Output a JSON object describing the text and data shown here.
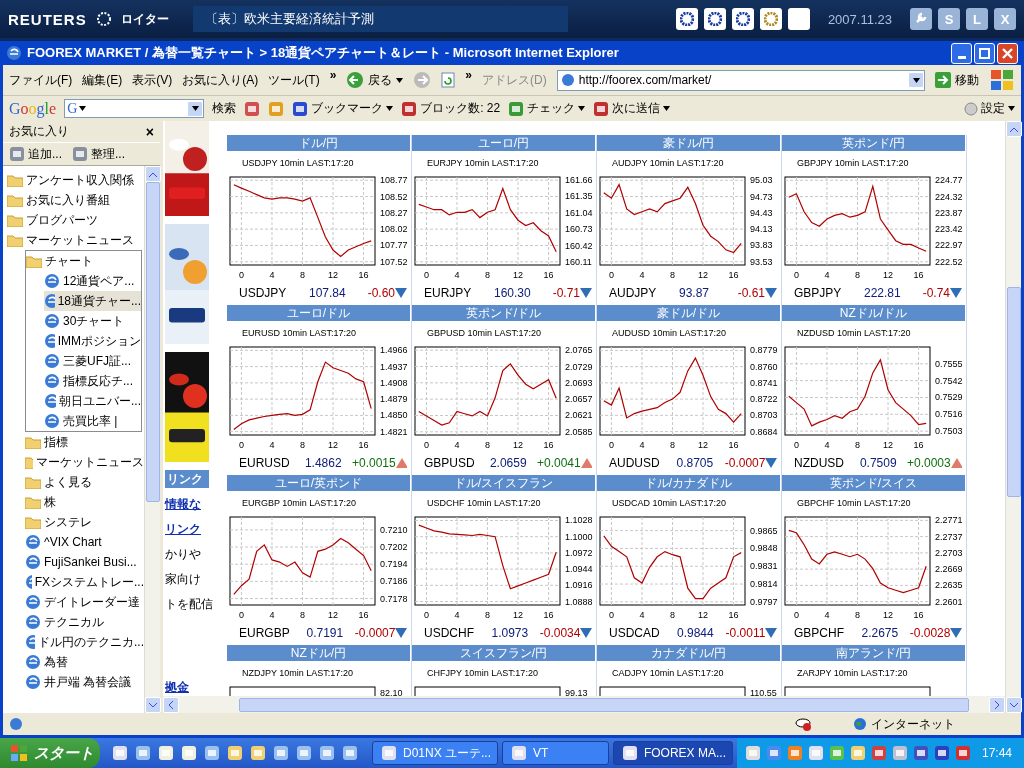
{
  "reuters": {
    "brand": "REUTERS",
    "brand_jp": "ロイター",
    "headline": "〔表〕欧米主要経済統計予測",
    "date": "2007.11.23",
    "buttons": [
      "S",
      "L",
      "X"
    ]
  },
  "window": {
    "title": "FOOREX MARKET / 為替一覧チャート > 18通貨ペアチャート＆レート - Microsoft Internet Explorer",
    "menu": [
      "ファイル(F)",
      "編集(E)",
      "表示(V)",
      "お気に入り(A)",
      "ツール(T)"
    ],
    "menu_chevron": "»",
    "back": "戻る",
    "nav_chevron": "»",
    "address_label": "アドレス(D)",
    "url": "http://foorex.com/market/",
    "go": "移動"
  },
  "google_bar": {
    "logo": "Google",
    "combo": "G",
    "search": "検索",
    "items": [
      {
        "label": "ブックマーク",
        "menu": true
      },
      {
        "label": "ブロック数: 22",
        "menu": false
      },
      {
        "label": "チェック",
        "menu": true
      },
      {
        "label": "次に送信",
        "menu": true
      }
    ],
    "settings": "設定"
  },
  "favorites": {
    "title": "お気に入り",
    "close": "×",
    "actions": [
      "追加...",
      "整理..."
    ],
    "items": [
      {
        "kind": "folder",
        "label": "アンケート収入関係",
        "selected": false
      },
      {
        "kind": "folder",
        "label": "お気に入り番組",
        "selected": false
      },
      {
        "kind": "folder",
        "label": "ブログパーツ",
        "selected": false
      },
      {
        "kind": "folder",
        "label": "マーケットニュース",
        "selected": false,
        "children": [
          {
            "kind": "folder",
            "label": "チャート",
            "selected": false,
            "children": [
              {
                "kind": "link",
                "label": "12通貨ペア...",
                "selected": false
              },
              {
                "kind": "link",
                "label": "18通貨チャー...",
                "selected": true
              },
              {
                "kind": "link",
                "label": "30チャート",
                "selected": false
              },
              {
                "kind": "link",
                "label": "IMMポジション",
                "selected": false
              },
              {
                "kind": "link",
                "label": "三菱UFJ証...",
                "selected": false
              },
              {
                "kind": "link",
                "label": "指標反応チ...",
                "selected": false
              },
              {
                "kind": "link",
                "label": "朝日ユニバー...",
                "selected": false
              },
              {
                "kind": "link",
                "label": "売買比率 |",
                "selected": false
              }
            ]
          },
          {
            "kind": "folder",
            "label": "指標",
            "selected": false
          },
          {
            "kind": "folder",
            "label": "マーケットニュース",
            "selected": false
          },
          {
            "kind": "folder",
            "label": "よく見る",
            "selected": false
          },
          {
            "kind": "folder",
            "label": "株",
            "selected": false
          },
          {
            "kind": "folder",
            "label": "システレ",
            "selected": false
          },
          {
            "kind": "link",
            "label": "^VIX Chart",
            "selected": false
          },
          {
            "kind": "link",
            "label": "FujiSankei Busi...",
            "selected": false
          },
          {
            "kind": "link",
            "label": "FXシステムトレー...",
            "selected": false
          },
          {
            "kind": "link",
            "label": "デイトレーダー達",
            "selected": false
          },
          {
            "kind": "link",
            "label": "テクニカル",
            "selected": false
          },
          {
            "kind": "link",
            "label": "ドル円のテクニカ...",
            "selected": false
          },
          {
            "kind": "link",
            "label": "為替",
            "selected": false
          },
          {
            "kind": "link",
            "label": "井戸端 為替会議",
            "selected": false
          }
        ]
      }
    ]
  },
  "side_column": {
    "ads": [
      {
        "kind": "picture"
      },
      {
        "kind": "picture"
      },
      {
        "kind": "picture"
      }
    ],
    "heading": "リンク",
    "links": [
      "情報な",
      "リンク"
    ],
    "lines": [
      "かりや",
      "家向け",
      "トを配信"
    ],
    "bottom_link": "拠金"
  },
  "panels": [
    {
      "kind": "chart",
      "heading": "ドル/円",
      "caption": "USDJPY 10min LAST:17:20",
      "symbol": "USDJPY",
      "price": "107.84",
      "change": "-0.60",
      "rising": false,
      "chart_data": {
        "type": "line",
        "grid": true,
        "x": [
          -1,
          0,
          1,
          2,
          3,
          4,
          5,
          6,
          7,
          8,
          9,
          10,
          11,
          12,
          13,
          14,
          15,
          16,
          17
        ],
        "xlim": [
          -1.5,
          17.5
        ],
        "ylim": [
          107.47,
          108.82
        ],
        "xticks": [
          0,
          4,
          8,
          12,
          16
        ],
        "yticks": [
          {
            "value": 108.77,
            "label": "108.77"
          },
          {
            "value": 108.52,
            "label": "108.52"
          },
          {
            "value": 108.27,
            "label": "108.27"
          },
          {
            "value": 108.02,
            "label": "108.02"
          },
          {
            "value": 107.77,
            "label": "107.77"
          },
          {
            "value": 107.52,
            "label": "107.52"
          }
        ],
        "series": [
          {
            "color": "#b00000",
            "values": [
              108.7,
              108.65,
              108.6,
              108.55,
              108.5,
              108.48,
              108.5,
              108.5,
              108.48,
              108.45,
              108.5,
              108.2,
              107.9,
              107.7,
              107.6,
              107.7,
              107.75,
              107.8,
              107.84
            ]
          }
        ]
      }
    },
    {
      "kind": "chart",
      "heading": "ユーロ/円",
      "caption": "EURJPY 10min LAST:17:20",
      "symbol": "EURJPY",
      "price": "160.30",
      "change": "-0.71",
      "rising": false,
      "chart_data": {
        "type": "line",
        "grid": true,
        "x": [
          -1,
          0,
          1,
          2,
          3,
          4,
          5,
          6,
          7,
          8,
          9,
          10,
          11,
          12,
          13,
          14,
          15,
          16,
          17
        ],
        "xlim": [
          -1.5,
          17.5
        ],
        "ylim": [
          160.05,
          161.72
        ],
        "xticks": [
          0,
          4,
          8,
          12,
          16
        ],
        "yticks": [
          {
            "value": 161.66,
            "label": "161.66"
          },
          {
            "value": 161.35,
            "label": "161.35"
          },
          {
            "value": 161.04,
            "label": "161.04"
          },
          {
            "value": 160.73,
            "label": "160.73"
          },
          {
            "value": 160.42,
            "label": "160.42"
          },
          {
            "value": 160.11,
            "label": "160.11"
          }
        ],
        "series": [
          {
            "color": "#b00000",
            "values": [
              161.2,
              161.15,
              161.1,
              161.1,
              161.0,
              161.05,
              161.05,
              161.1,
              160.95,
              161.05,
              161.1,
              161.5,
              161.1,
              160.9,
              160.8,
              160.85,
              160.7,
              160.6,
              160.3
            ]
          }
        ]
      }
    },
    {
      "kind": "chart",
      "heading": "豪ドル/円",
      "caption": "AUDJPY 10min LAST:17:20",
      "symbol": "AUDJPY",
      "price": "93.87",
      "change": "-0.61",
      "rising": false,
      "chart_data": {
        "type": "line",
        "grid": true,
        "x": [
          -1,
          0,
          1,
          2,
          3,
          4,
          5,
          6,
          7,
          8,
          9,
          10,
          11,
          12,
          13,
          14,
          15,
          16,
          17
        ],
        "xlim": [
          -1.5,
          17.5
        ],
        "ylim": [
          93.47,
          95.09
        ],
        "xticks": [
          0,
          4,
          8,
          12,
          16
        ],
        "yticks": [
          {
            "value": 95.03,
            "label": "95.03"
          },
          {
            "value": 94.73,
            "label": "94.73"
          },
          {
            "value": 94.43,
            "label": "94.43"
          },
          {
            "value": 94.13,
            "label": "94.13"
          },
          {
            "value": 93.83,
            "label": "93.83"
          },
          {
            "value": 93.53,
            "label": "93.53"
          }
        ],
        "series": [
          {
            "color": "#b00000",
            "values": [
              94.8,
              94.7,
              94.95,
              94.5,
              94.4,
              94.45,
              94.5,
              94.45,
              94.6,
              94.65,
              94.7,
              94.9,
              94.6,
              94.2,
              94.0,
              93.9,
              93.75,
              93.7,
              93.87
            ]
          }
        ]
      }
    },
    {
      "kind": "chart",
      "heading": "英ポンド/円",
      "caption": "GBPJPY 10min LAST:17:20",
      "symbol": "GBPJPY",
      "price": "222.81",
      "change": "-0.74",
      "rising": false,
      "chart_data": {
        "type": "line",
        "grid": true,
        "x": [
          -1,
          0,
          1,
          2,
          3,
          4,
          5,
          6,
          7,
          8,
          9,
          10,
          11,
          12,
          13,
          14,
          15,
          16,
          17
        ],
        "xlim": [
          -1.5,
          17.5
        ],
        "ylim": [
          222.43,
          224.86
        ],
        "xticks": [
          0,
          4,
          8,
          12,
          16
        ],
        "yticks": [
          {
            "value": 224.77,
            "label": "224.77"
          },
          {
            "value": 224.32,
            "label": "224.32"
          },
          {
            "value": 223.87,
            "label": "223.87"
          },
          {
            "value": 223.42,
            "label": "223.42"
          },
          {
            "value": 222.97,
            "label": "222.97"
          },
          {
            "value": 222.52,
            "label": "222.52"
          }
        ],
        "series": [
          {
            "color": "#b00000",
            "values": [
              224.3,
              224.4,
              223.9,
              223.6,
              223.5,
              223.7,
              223.8,
              223.85,
              223.75,
              223.8,
              223.9,
              224.6,
              223.7,
              223.4,
              223.1,
              223.0,
              223.0,
              222.9,
              222.81
            ]
          }
        ]
      }
    },
    {
      "kind": "chart",
      "heading": "ユーロ/ドル",
      "caption": "EURUSD 10min LAST:17:20",
      "symbol": "EURUSD",
      "price": "1.4862",
      "change": "+0.0015",
      "rising": true,
      "chart_data": {
        "type": "line",
        "grid": true,
        "x": [
          -1,
          0,
          1,
          2,
          3,
          4,
          5,
          6,
          7,
          8,
          9,
          10,
          11,
          12,
          13,
          14,
          15,
          16,
          17
        ],
        "xlim": [
          -1.5,
          17.5
        ],
        "ylim": [
          1.4815,
          1.4972
        ],
        "xticks": [
          0,
          4,
          8,
          12,
          16
        ],
        "yticks": [
          {
            "value": 1.4966,
            "label": "1.4966"
          },
          {
            "value": 1.4937,
            "label": "1.4937"
          },
          {
            "value": 1.4908,
            "label": "1.4908"
          },
          {
            "value": 1.4879,
            "label": "1.4879"
          },
          {
            "value": 1.485,
            "label": "1.4850"
          },
          {
            "value": 1.4821,
            "label": "1.4821"
          }
        ],
        "series": [
          {
            "color": "#b00000",
            "values": [
              1.4825,
              1.4835,
              1.4842,
              1.4845,
              1.4848,
              1.485,
              1.4852,
              1.4853,
              1.485,
              1.4852,
              1.486,
              1.491,
              1.4945,
              1.4935,
              1.493,
              1.4925,
              1.4915,
              1.491,
              1.4862
            ]
          }
        ]
      }
    },
    {
      "kind": "chart",
      "heading": "英ポンド/ドル",
      "caption": "GBPUSD 10min LAST:17:20",
      "symbol": "GBPUSD",
      "price": "2.0659",
      "change": "+0.0041",
      "rising": true,
      "chart_data": {
        "type": "line",
        "grid": true,
        "x": [
          -1,
          0,
          1,
          2,
          3,
          4,
          5,
          6,
          7,
          8,
          9,
          10,
          11,
          12,
          13,
          14,
          15,
          16,
          17
        ],
        "xlim": [
          -1.5,
          17.5
        ],
        "ylim": [
          2.0578,
          2.0772
        ],
        "xticks": [
          0,
          4,
          8,
          12,
          16
        ],
        "yticks": [
          {
            "value": 2.0765,
            "label": "2.0765"
          },
          {
            "value": 2.0729,
            "label": "2.0729"
          },
          {
            "value": 2.0693,
            "label": "2.0693"
          },
          {
            "value": 2.0657,
            "label": "2.0657"
          },
          {
            "value": 2.0621,
            "label": "2.0621"
          },
          {
            "value": 2.0585,
            "label": "2.0585"
          }
        ],
        "series": [
          {
            "color": "#b00000",
            "values": [
              2.063,
              2.062,
              2.061,
              2.06,
              2.0605,
              2.063,
              2.0625,
              2.062,
              2.063,
              2.062,
              2.066,
              2.072,
              2.0735,
              2.071,
              2.069,
              2.068,
              2.069,
              2.07,
              2.0659
            ]
          }
        ]
      }
    },
    {
      "kind": "chart",
      "heading": "豪ドル/ドル",
      "caption": "AUDUSD 10min LAST:17:20",
      "symbol": "AUDUSD",
      "price": "0.8705",
      "change": "-0.0007",
      "rising": false,
      "chart_data": {
        "type": "line",
        "grid": true,
        "x": [
          -1,
          0,
          1,
          2,
          3,
          4,
          5,
          6,
          7,
          8,
          9,
          10,
          11,
          12,
          13,
          14,
          15,
          16,
          17
        ],
        "xlim": [
          -1.5,
          17.5
        ],
        "ylim": [
          0.868,
          0.8783
        ],
        "xticks": [
          0,
          4,
          8,
          12,
          16
        ],
        "yticks": [
          {
            "value": 0.8779,
            "label": "0.8779"
          },
          {
            "value": 0.876,
            "label": "0.8760"
          },
          {
            "value": 0.8741,
            "label": "0.8741"
          },
          {
            "value": 0.8722,
            "label": "0.8722"
          },
          {
            "value": 0.8703,
            "label": "0.8703"
          },
          {
            "value": 0.8684,
            "label": "0.8684"
          }
        ],
        "series": [
          {
            "color": "#b00000",
            "values": [
              0.872,
              0.8715,
              0.8735,
              0.87,
              0.8705,
              0.8708,
              0.871,
              0.8712,
              0.8718,
              0.8722,
              0.873,
              0.8755,
              0.877,
              0.875,
              0.8725,
              0.871,
              0.8705,
              0.8695,
              0.8705
            ]
          }
        ]
      }
    },
    {
      "kind": "chart",
      "heading": "NZドル/ドル",
      "caption": "NZDUSD 10min LAST:17:20",
      "symbol": "NZDUSD",
      "price": "0.7509",
      "change": "+0.0003",
      "rising": true,
      "chart_data": {
        "type": "line",
        "grid": true,
        "x": [
          -1,
          0,
          1,
          2,
          3,
          4,
          5,
          6,
          7,
          8,
          9,
          10,
          11,
          12,
          13,
          14,
          15,
          16,
          17
        ],
        "xlim": [
          -1.5,
          17.5
        ],
        "ylim": [
          0.75,
          0.7568
        ],
        "xticks": [
          0,
          4,
          8,
          12,
          16
        ],
        "yticks": [
          {
            "value": 0.7555,
            "label": "0.7555"
          },
          {
            "value": 0.7542,
            "label": "0.7542"
          },
          {
            "value": 0.7529,
            "label": "0.7529"
          },
          {
            "value": 0.7516,
            "label": "0.7516"
          },
          {
            "value": 0.7503,
            "label": "0.7503"
          }
        ],
        "series": [
          {
            "color": "#b00000",
            "values": [
              0.753,
              0.7525,
              0.752,
              0.7507,
              0.751,
              0.7512,
              0.7515,
              0.7513,
              0.7518,
              0.752,
              0.753,
              0.7548,
              0.7558,
              0.7535,
              0.7525,
              0.752,
              0.7515,
              0.7508,
              0.7509
            ]
          }
        ]
      }
    },
    {
      "kind": "chart",
      "heading": "ユーロ/英ポンド",
      "caption": "EURGBP 10min LAST:17:20",
      "symbol": "EURGBP",
      "price": "0.7191",
      "change": "-0.0007",
      "rising": false,
      "chart_data": {
        "type": "line",
        "grid": true,
        "x": [
          -1,
          0,
          1,
          2,
          3,
          4,
          5,
          6,
          7,
          8,
          9,
          10,
          11,
          12,
          13,
          14,
          15,
          16,
          17
        ],
        "xlim": [
          -1.5,
          17.5
        ],
        "ylim": [
          0.7175,
          0.7216
        ],
        "xticks": [
          0,
          4,
          8,
          12,
          16
        ],
        "yticks": [
          {
            "value": 0.721,
            "label": "0.7210"
          },
          {
            "value": 0.7202,
            "label": "0.7202"
          },
          {
            "value": 0.7194,
            "label": "0.7194"
          },
          {
            "value": 0.7186,
            "label": "0.7186"
          },
          {
            "value": 0.7178,
            "label": "0.7178"
          }
        ],
        "series": [
          {
            "color": "#b00000",
            "values": [
              0.718,
              0.7184,
              0.7187,
              0.72,
              0.7203,
              0.7196,
              0.7195,
              0.7193,
              0.7195,
              0.719,
              0.7188,
              0.72,
              0.7201,
              0.7203,
              0.7206,
              0.7204,
              0.7201,
              0.7198,
              0.7191
            ]
          }
        ]
      }
    },
    {
      "kind": "chart",
      "heading": "ドル/スイスフラン",
      "caption": "USDCHF 10min LAST:17:20",
      "symbol": "USDCHF",
      "price": "1.0973",
      "change": "-0.0034",
      "rising": false,
      "chart_data": {
        "type": "line",
        "grid": true,
        "x": [
          -1,
          0,
          1,
          2,
          3,
          4,
          5,
          6,
          7,
          8,
          9,
          10,
          11,
          12,
          13,
          14,
          15,
          16,
          17
        ],
        "xlim": [
          -1.5,
          17.5
        ],
        "ylim": [
          1.0882,
          1.1034
        ],
        "xticks": [
          0,
          4,
          8,
          12,
          16
        ],
        "yticks": [
          {
            "value": 1.1028,
            "label": "1.1028"
          },
          {
            "value": 1.1,
            "label": "1.1000"
          },
          {
            "value": 1.0972,
            "label": "1.0972"
          },
          {
            "value": 1.0944,
            "label": "1.0944"
          },
          {
            "value": 1.0916,
            "label": "1.0916"
          },
          {
            "value": 1.0888,
            "label": "1.0888"
          }
        ],
        "series": [
          {
            "color": "#b00000",
            "values": [
              1.102,
              1.1015,
              1.101,
              1.1008,
              1.1005,
              1.1004,
              1.1003,
              1.1002,
              1.1004,
              1.1002,
              1.1,
              1.095,
              1.091,
              1.0915,
              1.092,
              1.0925,
              1.093,
              1.0935,
              1.0973
            ]
          }
        ]
      }
    },
    {
      "kind": "chart",
      "heading": "ドル/カナダドル",
      "caption": "USDCAD 10min LAST:17:20",
      "symbol": "USDCAD",
      "price": "0.9844",
      "change": "-0.0011",
      "rising": false,
      "chart_data": {
        "type": "line",
        "grid": true,
        "x": [
          -1,
          0,
          1,
          2,
          3,
          4,
          5,
          6,
          7,
          8,
          9,
          10,
          11,
          12,
          13,
          14,
          15,
          16,
          17
        ],
        "xlim": [
          -1.5,
          17.5
        ],
        "ylim": [
          0.9794,
          0.9878
        ],
        "xticks": [
          0,
          4,
          8,
          12,
          16
        ],
        "yticks": [
          {
            "value": 0.9865,
            "label": "0.9865"
          },
          {
            "value": 0.9848,
            "label": "0.9848"
          },
          {
            "value": 0.9831,
            "label": "0.9831"
          },
          {
            "value": 0.9814,
            "label": "0.9814"
          },
          {
            "value": 0.9797,
            "label": "0.9797"
          }
        ],
        "series": [
          {
            "color": "#b00000",
            "values": [
              0.986,
              0.985,
              0.9845,
              0.984,
              0.982,
              0.9815,
              0.983,
              0.984,
              0.9845,
              0.9842,
              0.984,
              0.981,
              0.98,
              0.98,
              0.981,
              0.9815,
              0.982,
              0.984,
              0.9844
            ]
          }
        ]
      }
    },
    {
      "kind": "chart",
      "heading": "英ポンド/スイス",
      "caption": "GBPCHF 10min LAST:17:20",
      "symbol": "GBPCHF",
      "price": "2.2675",
      "change": "-0.0028",
      "rising": false,
      "chart_data": {
        "type": "line",
        "grid": true,
        "x": [
          -1,
          0,
          1,
          2,
          3,
          4,
          5,
          6,
          7,
          8,
          9,
          10,
          11,
          12,
          13,
          14,
          15,
          16,
          17
        ],
        "xlim": [
          -1.5,
          17.5
        ],
        "ylim": [
          2.2594,
          2.2778
        ],
        "xticks": [
          0,
          4,
          8,
          12,
          16
        ],
        "yticks": [
          {
            "value": 2.2771,
            "label": "2.2771"
          },
          {
            "value": 2.2737,
            "label": "2.2737"
          },
          {
            "value": 2.2703,
            "label": "2.2703"
          },
          {
            "value": 2.2669,
            "label": "2.2669"
          },
          {
            "value": 2.2635,
            "label": "2.2635"
          },
          {
            "value": 2.2601,
            "label": "2.2601"
          }
        ],
        "series": [
          {
            "color": "#b00000",
            "values": [
              2.275,
              2.2745,
              2.272,
              2.269,
              2.268,
              2.27,
              2.2705,
              2.27,
              2.2695,
              2.27,
              2.269,
              2.267,
              2.264,
              2.263,
              2.2625,
              2.262,
              2.2625,
              2.263,
              2.2675
            ]
          }
        ]
      }
    },
    {
      "kind": "cut",
      "heading": "NZドル/円",
      "caption": "NZDJPY 10min LAST:17:20",
      "top_tick": "82.10"
    },
    {
      "kind": "cut",
      "heading": "スイスフラン/円",
      "caption": "CHFJPY 10min LAST:17:20",
      "top_tick": "99.13"
    },
    {
      "kind": "cut",
      "heading": "カナダドル/円",
      "caption": "CADJPY 10min LAST:17:20",
      "top_tick": "110.55"
    },
    {
      "kind": "cut",
      "heading": "南アランド/円",
      "caption": "ZARJPY 10min LAST:17:20"
    }
  ],
  "status_bar": {
    "zone": "インターネット"
  },
  "taskbar": {
    "start": "スタート",
    "tasks": [
      {
        "label": "D01NX ユーテ...",
        "selected": false
      },
      {
        "label": "VT",
        "selected": false
      },
      {
        "label": "FOOREX MA...",
        "selected": true
      }
    ],
    "clock": "17:44"
  }
}
